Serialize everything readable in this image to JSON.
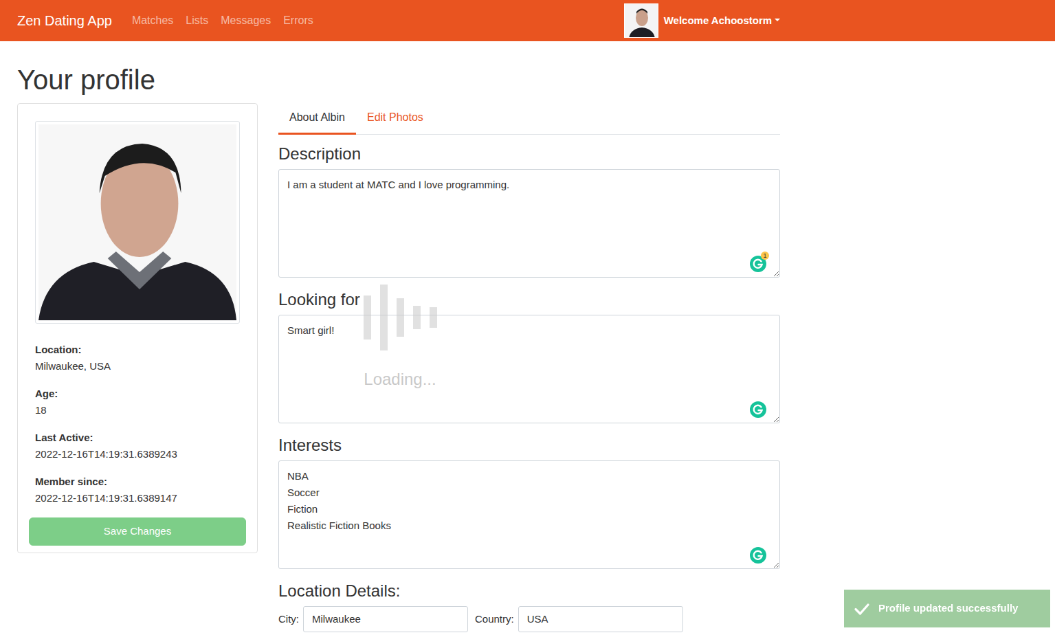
{
  "navbar": {
    "brand": "Zen Dating App",
    "links": [
      {
        "label": "Matches"
      },
      {
        "label": "Lists"
      },
      {
        "label": "Messages"
      },
      {
        "label": "Errors"
      }
    ],
    "welcome": "Welcome Achoostorm"
  },
  "page": {
    "title": "Your profile"
  },
  "profile_card": {
    "details": [
      {
        "label": "Location:",
        "value": "Milwaukee, USA"
      },
      {
        "label": "Age:",
        "value": "18"
      },
      {
        "label": "Last Active:",
        "value": "2022-12-16T14:19:31.6389243"
      },
      {
        "label": "Member since:",
        "value": "2022-12-16T14:19:31.6389147"
      }
    ],
    "save_button": {
      "label": "Save Changes",
      "disabled": true
    }
  },
  "tabs": [
    {
      "label": "About Albin",
      "selected": true
    },
    {
      "label": "Edit Photos",
      "selected": false
    }
  ],
  "sections": [
    {
      "heading": "Description",
      "text": "I am a student at MATC and I love programming.",
      "badge": "1"
    },
    {
      "heading": "Looking for",
      "text": "Smart girl!"
    },
    {
      "heading": "Interests",
      "text": "NBA\nSoccer\nFiction\nRealistic Fiction Books"
    }
  ],
  "location": {
    "heading": "Location Details:",
    "city_label": "City:",
    "city": "Milwaukee",
    "country_label": "Country:",
    "country": "USA"
  },
  "loading": {
    "text": "Loading..."
  },
  "toast": {
    "text": "Profile updated successfully"
  }
}
